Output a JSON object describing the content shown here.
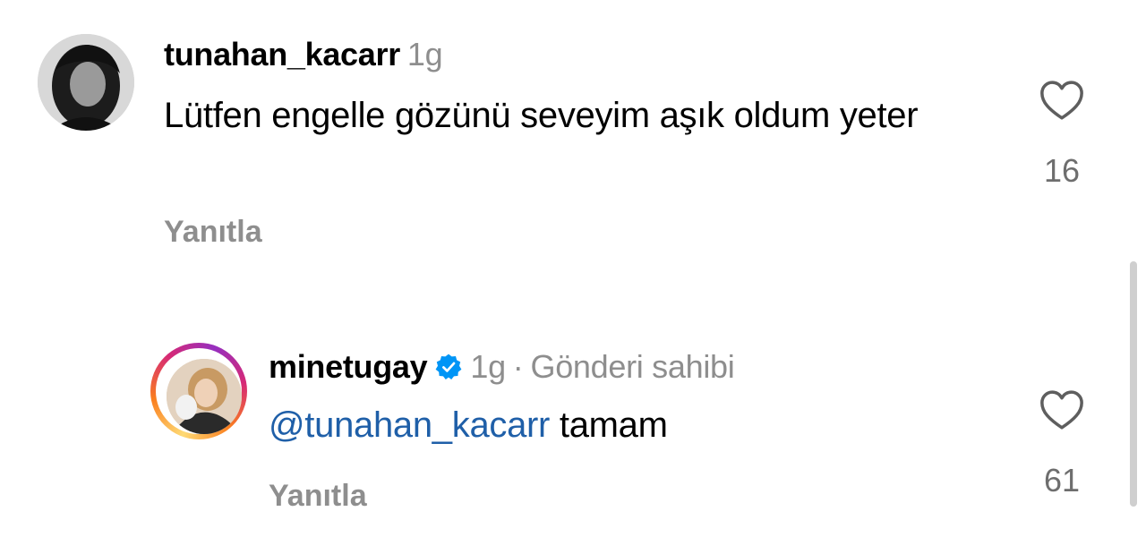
{
  "comments": [
    {
      "username": "tunahan_kacarr",
      "time": "1g",
      "text": "Lütfen engelle gözünü seveyim aşık oldum yeter",
      "reply_label": "Yanıtla",
      "likes": "16",
      "avatar_icon": "user-avatar-photo",
      "like_icon": "heart-outline-icon"
    }
  ],
  "reply": {
    "username": "minetugay",
    "verified": true,
    "time": "1g",
    "separator": "·",
    "author_label": "Gönderi sahibi",
    "mention": "@tunahan_kacarr",
    "text": "tamam",
    "reply_label": "Yanıtla",
    "likes": "61",
    "avatar_icon": "story-ring-avatar-photo",
    "verified_icon": "verified-badge-icon",
    "like_icon": "heart-outline-icon"
  },
  "colors": {
    "secondary_text": "#8e8e8e",
    "like_count": "#6e6e6e",
    "mention": "#1f5fa8",
    "verified_badge": "#0095f6"
  }
}
